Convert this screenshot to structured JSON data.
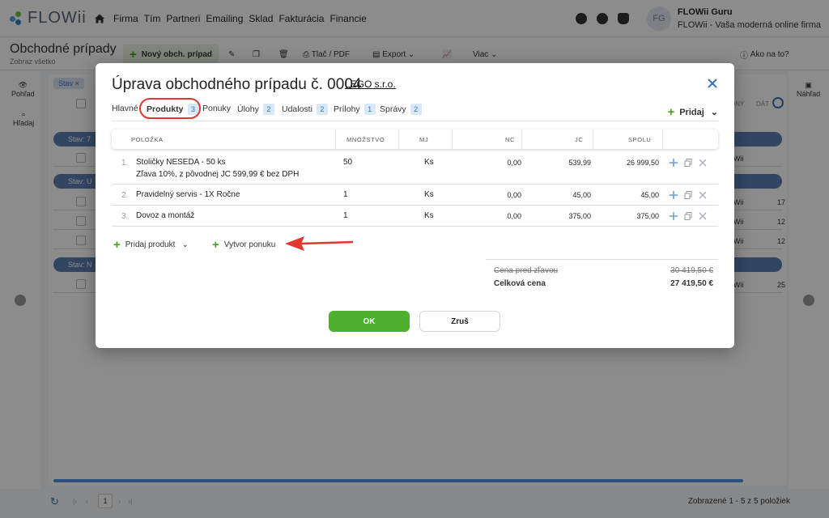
{
  "app": {
    "logo_text": "FLOWii",
    "nav": [
      "Firma",
      "Tím",
      "Partneri",
      "Emailing",
      "Sklad",
      "Fakturácia",
      "Financie"
    ],
    "user_initials": "FG",
    "user_name": "FLOWii Guru",
    "user_subtitle": "FLOWii - Vaša moderná online firma"
  },
  "page": {
    "title": "Obchodné prípady",
    "subtitle": "Zobraz všetko",
    "new_button": "Nový obch. prípad",
    "print_label": "Tlač / PDF",
    "export_label": "Export",
    "more_label": "Viac",
    "help_label": "Ako na to?"
  },
  "background": {
    "left_side": {
      "view": "Pohľad",
      "search": "Hľadaj"
    },
    "right_side": {
      "preview": "Náhľad"
    },
    "filter_chip": "Stav",
    "header_partial": {
      "a": "ONÝ",
      "b": "DÁT"
    },
    "groups": [
      "Stav: 7",
      "Stav: U",
      "Stav: N"
    ],
    "rows": [
      {
        "a": "Wii",
        "b": ""
      },
      {
        "a": "Wii",
        "b": "17"
      },
      {
        "a": "Wii",
        "b": "12"
      },
      {
        "a": "Wii",
        "b": "12"
      },
      {
        "a": "Wii",
        "b": "25"
      }
    ],
    "pager_current": "1",
    "pager_summary": "Zobrazené 1 - 5 z 5 položiek"
  },
  "modal": {
    "title": "Úprava obchodného prípadu č. 0004",
    "company_link": "LEGO s.r.o.",
    "tabs": [
      {
        "label": "Hlavné",
        "badge": ""
      },
      {
        "label": "Produkty",
        "badge": "3"
      },
      {
        "label": "Ponuky",
        "badge": ""
      },
      {
        "label": "Úlohy",
        "badge": "2"
      },
      {
        "label": "Udalosti",
        "badge": "2"
      },
      {
        "label": "Prílohy",
        "badge": "1"
      },
      {
        "label": "Správy",
        "badge": "2"
      }
    ],
    "add_label": "Pridaj",
    "columns": {
      "item": "POLOŽKA",
      "qty": "MNOŽSTVO",
      "unit": "MJ",
      "nc": "NC",
      "jc": "JC",
      "total": "SPOLU"
    },
    "items": [
      {
        "num": "1.",
        "name": "Stoličky NESEDA - 50 ks",
        "note": "Zľava 10%, z pôvodnej JC 599,99 € bez DPH",
        "qty": "50",
        "unit": "Ks",
        "nc": "0,00",
        "jc": "539,99",
        "total": "26 999,50"
      },
      {
        "num": "2.",
        "name": "Pravidelný servis - 1X Ročne",
        "note": "",
        "qty": "1",
        "unit": "Ks",
        "nc": "0,00",
        "jc": "45,00",
        "total": "45,00"
      },
      {
        "num": "3.",
        "name": "Dovoz a montáž",
        "note": "",
        "qty": "1",
        "unit": "Ks",
        "nc": "0,00",
        "jc": "375,00",
        "total": "375,00"
      }
    ],
    "add_product": "Pridaj produkt",
    "create_offer": "Vytvor ponuku",
    "price_before_label": "Cena pred zľavou",
    "price_before_value": "30 419,50 €",
    "total_label": "Celková cena",
    "total_value": "27 419,50 €",
    "ok_label": "OK",
    "cancel_label": "Zruš"
  },
  "colors": {
    "accent_green": "#4caf2e",
    "link_blue": "#3a73b5",
    "highlight_red": "#e0372e",
    "group_blue": "#5b80b2"
  }
}
